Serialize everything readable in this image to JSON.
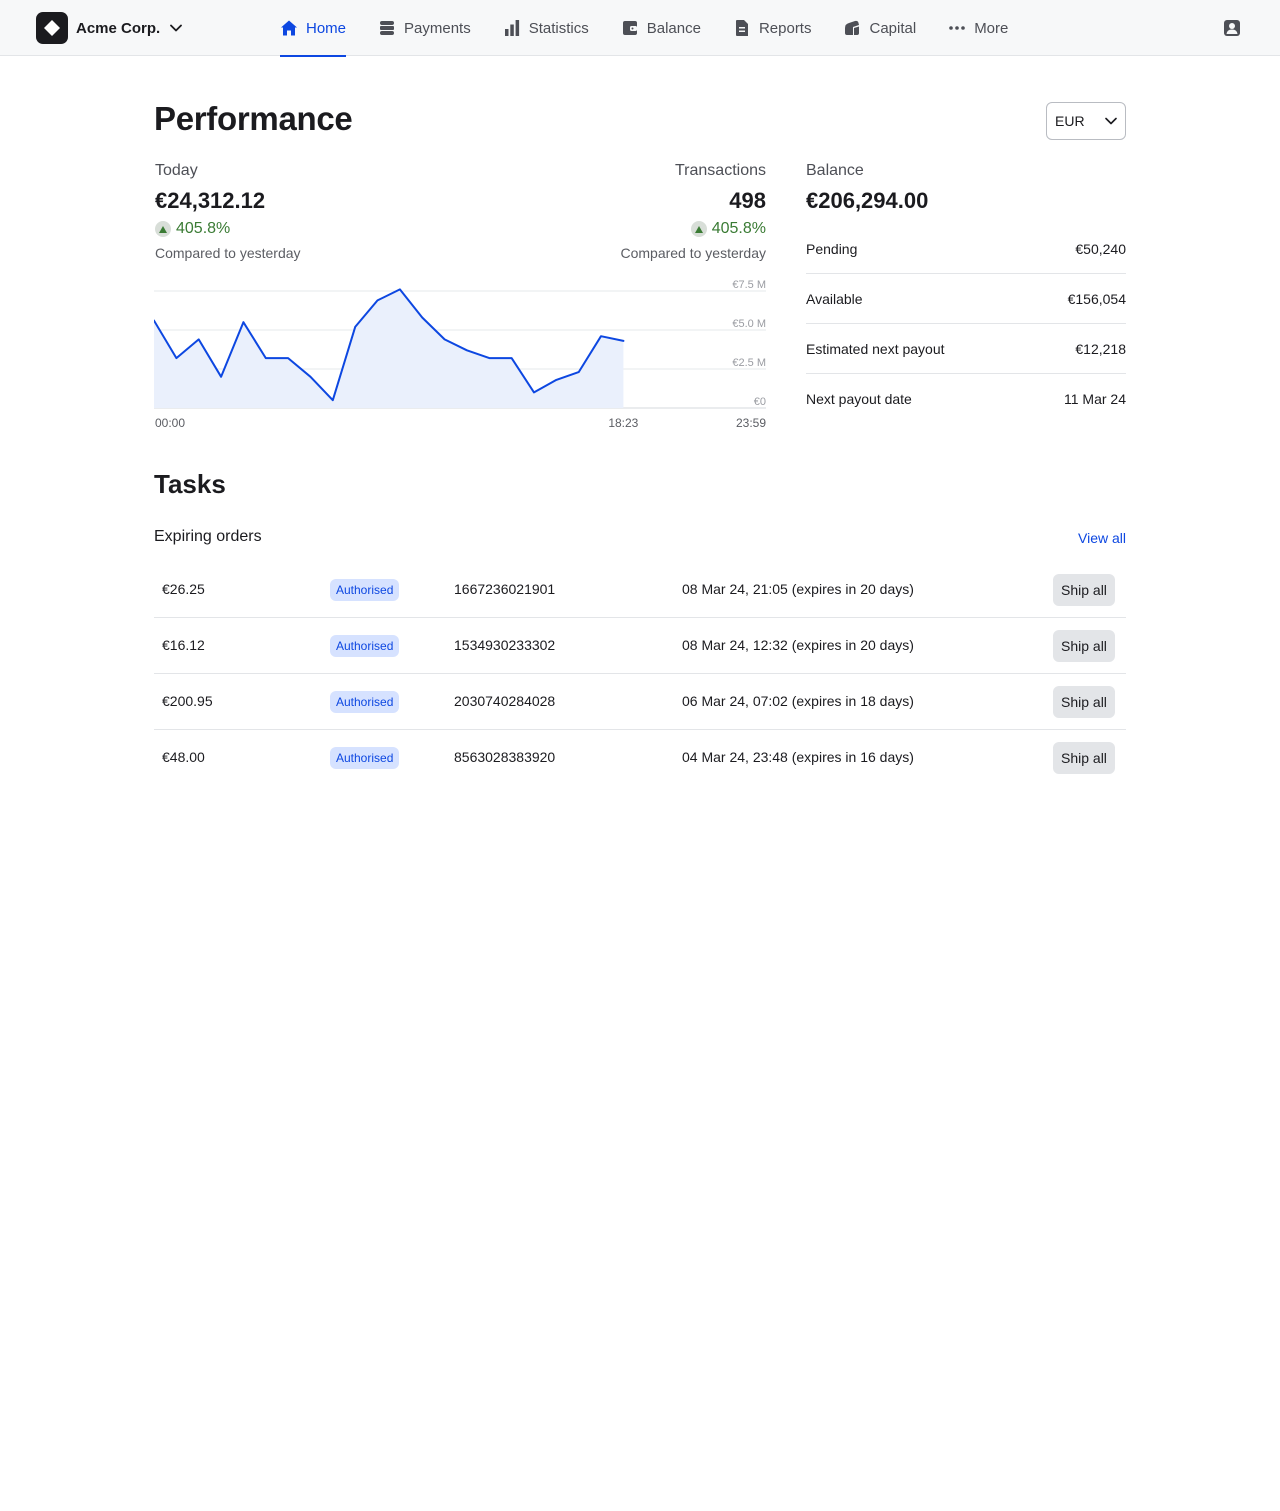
{
  "app": {
    "company": "Acme Corp.",
    "logo_icon": "diamond-icon",
    "profile_icon": "user-icon"
  },
  "nav": [
    {
      "label": "Home",
      "icon": "home-icon",
      "active": true
    },
    {
      "label": "Payments",
      "icon": "database-icon",
      "active": false
    },
    {
      "label": "Statistics",
      "icon": "bar-chart-icon",
      "active": false
    },
    {
      "label": "Balance",
      "icon": "wallet-icon",
      "active": false
    },
    {
      "label": "Reports",
      "icon": "document-icon",
      "active": false
    },
    {
      "label": "Capital",
      "icon": "capital-icon",
      "active": false
    },
    {
      "label": "More",
      "icon": "more-icon",
      "active": false
    }
  ],
  "colors": {
    "accent": "#0d47e1",
    "positive": "#3a7b34",
    "badge_bg": "#d6e2ff"
  },
  "performance": {
    "title": "Performance",
    "currency": "EUR",
    "today": {
      "label": "Today",
      "value": "€24,312.12",
      "change": "405.8%",
      "sub": "Compared to yesterday"
    },
    "transactions": {
      "label": "Transactions",
      "value": "498",
      "change": "405.8%",
      "sub": "Compared to yesterday"
    }
  },
  "chart_data": {
    "type": "area",
    "x": [
      "00:00",
      "01:00",
      "02:00",
      "03:00",
      "04:00",
      "05:00",
      "06:00",
      "07:00",
      "08:00",
      "09:00",
      "10:00",
      "11:00",
      "12:00",
      "13:00",
      "14:00",
      "15:00",
      "16:00",
      "17:00",
      "18:00",
      "18:23"
    ],
    "values": [
      5.6,
      3.2,
      4.4,
      2.0,
      5.5,
      3.2,
      3.2,
      2.0,
      0.5,
      5.2,
      6.9,
      7.6,
      5.8,
      4.4,
      3.7,
      3.2,
      3.2,
      1.0,
      1.8,
      2.3,
      4.6,
      4.3
    ],
    "series": [
      {
        "name": "",
        "values": [
          5.6,
          3.2,
          4.4,
          2.0,
          5.5,
          3.2,
          3.2,
          2.0,
          0.5,
          5.2,
          6.9,
          7.6,
          5.8,
          4.4,
          3.7,
          3.2,
          3.2,
          1.0,
          1.8,
          2.3,
          4.6,
          4.3
        ]
      }
    ],
    "x_ticks": [
      "00:00",
      "18:23",
      "23:59"
    ],
    "y_ticks": [
      "€7.5 M",
      "€5.0 M",
      "€2.5 M",
      "€0"
    ],
    "ylim": [
      0,
      7.5
    ],
    "points_count": 22,
    "total_slots": 29,
    "grid": true,
    "line_color": "#0d47e1",
    "fill_color": "#eaf0fc"
  },
  "balance": {
    "label": "Balance",
    "value": "€206,294.00",
    "rows": [
      {
        "label": "Pending",
        "value": "€50,240"
      },
      {
        "label": "Available",
        "value": "€156,054"
      },
      {
        "label": "Estimated next payout",
        "value": "€12,218"
      },
      {
        "label": "Next payout date",
        "value": "11 Mar 24"
      }
    ]
  },
  "tasks": {
    "title": "Tasks",
    "subtitle": "Expiring orders",
    "view_all": "View all",
    "orders": [
      {
        "amount": "€26.25",
        "status": "Authorised",
        "reference": "1667236021901",
        "date": "08 Mar 24, 21:05 (expires in 20 days)",
        "action": "Ship all"
      },
      {
        "amount": "€16.12",
        "status": "Authorised",
        "reference": "1534930233302",
        "date": "08 Mar 24, 12:32 (expires in 20 days)",
        "action": "Ship all"
      },
      {
        "amount": "€200.95",
        "status": "Authorised",
        "reference": "2030740284028",
        "date": "06 Mar 24, 07:02 (expires in 18 days)",
        "action": "Ship all"
      },
      {
        "amount": "€48.00",
        "status": "Authorised",
        "reference": "8563028383920",
        "date": "04 Mar 24, 23:48 (expires in 16 days)",
        "action": "Ship all"
      }
    ]
  }
}
